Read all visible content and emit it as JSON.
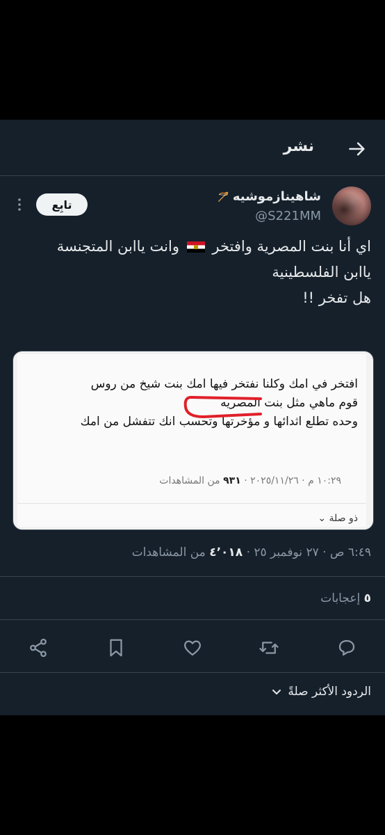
{
  "header": {
    "title": "نشر"
  },
  "author": {
    "display_name": "شاهينازموشيه",
    "username": "@S221MM",
    "follow_label": "تابِع"
  },
  "tweet": {
    "lines": [
      "اي أنا بنت المصرية وافتخر 🇪🇬 وانت ياابن المتجنسة",
      "ياابن الفلسطينية",
      "هل تفخر !!"
    ],
    "line1_before_flag": "اي أنا بنت المصرية وافتخر",
    "line1_after_flag": "وانت ياابن المتجنسة"
  },
  "media": {
    "lines": [
      "افتخر في امك وكلنا نفتخر فيها امك بنت شيخ من روس",
      "قوم ماهي مثل بنت المصريه",
      "وحده تطلع اثدائها و مؤخرتها وتحسب انك تتفشل من امك"
    ],
    "meta_prefix": "١٠:٢٩ م · ٢٠٢٥/١١/٢٦ ·",
    "meta_views": "٩٣١",
    "meta_suffix": "من المشاهدات",
    "relevance": "ذو صلة"
  },
  "tweet_meta": {
    "prefix": "٦:٤٩ ص · ٢٧ نوفمبر ٢٥ ·",
    "views": "٤٬٠١٨",
    "suffix": "من المشاهدات"
  },
  "likes": {
    "count": "٥",
    "label": "إعجابات"
  },
  "sort": {
    "label": "الردود الأكثر صلةً"
  },
  "icons": {
    "back": "arrow-right-icon",
    "more": "more-vertical-icon",
    "reply": "reply-icon",
    "retweet": "retweet-icon",
    "like": "heart-icon",
    "bookmark": "bookmark-icon",
    "share": "share-icon"
  },
  "colors": {
    "background": "#15202b",
    "text": "#e7e9ea",
    "muted": "#8b98a5",
    "divider": "#38444d"
  }
}
